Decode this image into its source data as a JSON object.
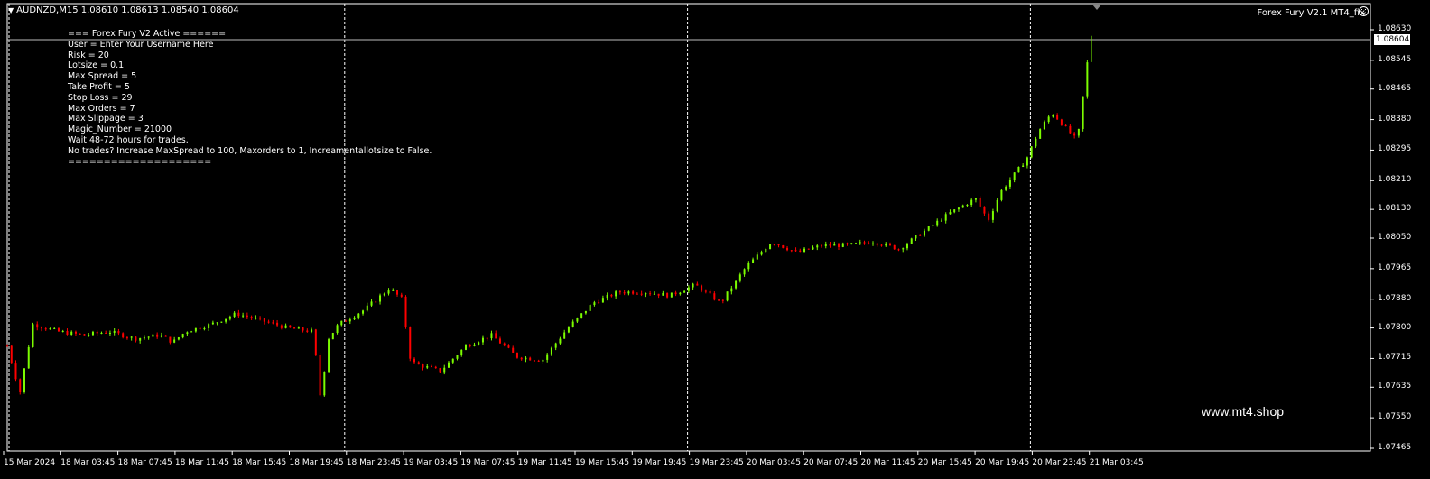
{
  "header": {
    "symbol_line": "AUDNZD,M15  1.08610 1.08613 1.08540 1.08604",
    "ea_title": "Forex Fury V2.1 MT4_fix"
  },
  "info_panel": [
    "=== Forex Fury V2 Active ======",
    "User = Enter Your Username Here",
    "Risk = 20",
    "Lotsize = 0.1",
    "Max Spread = 5",
    "Take Profit = 5",
    "Stop Loss = 29",
    "Max Orders = 7",
    "Max Slippage = 3",
    "Magic_Number = 21000",
    "Wait 48-72 hours for trades.",
    "No trades? Increase MaxSpread to 100, Maxorders to 1, Increamentallotsize to False.",
    "===================="
  ],
  "watermark": "www.mt4.shop",
  "current_price_label": "1.08604",
  "colors": {
    "bull": "#7CFC00",
    "bear": "#FF0000",
    "background": "#000000",
    "grid": "#FFFFFF"
  },
  "chart_data": {
    "type": "candlestick",
    "symbol": "AUDNZD",
    "timeframe": "M15",
    "ohlc_current": {
      "open": 1.0861,
      "high": 1.08613,
      "low": 1.0854,
      "close": 1.08604
    },
    "ylim": [
      1.07465,
      1.0866
    ],
    "y_ticks": [
      "1.08630",
      "1.08545",
      "1.08465",
      "1.08380",
      "1.08295",
      "1.08210",
      "1.08130",
      "1.08050",
      "1.07965",
      "1.07880",
      "1.07800",
      "1.07715",
      "1.07635",
      "1.07550",
      "1.07465"
    ],
    "x_ticks": [
      "15 Mar 2024",
      "18 Mar 03:45",
      "18 Mar 07:45",
      "18 Mar 11:45",
      "18 Mar 15:45",
      "18 Mar 19:45",
      "18 Mar 23:45",
      "19 Mar 03:45",
      "19 Mar 07:45",
      "19 Mar 11:45",
      "19 Mar 15:45",
      "19 Mar 19:45",
      "19 Mar 23:45",
      "20 Mar 03:45",
      "20 Mar 07:45",
      "20 Mar 11:45",
      "20 Mar 15:45",
      "20 Mar 19:45",
      "20 Mar 23:45",
      "21 Mar 03:45"
    ],
    "day_separators": [
      "15 Mar 2024",
      "18 Mar 23:45",
      "19 Mar 23:45",
      "20 Mar 23:45"
    ],
    "close_path": [
      {
        "t": 0,
        "v": 1.0775
      },
      {
        "t": 0.5,
        "v": 1.0762
      },
      {
        "t": 1,
        "v": 1.0781
      },
      {
        "t": 2,
        "v": 1.0779
      },
      {
        "t": 3,
        "v": 1.0778
      },
      {
        "t": 4,
        "v": 1.0779
      },
      {
        "t": 5,
        "v": 1.0777
      },
      {
        "t": 6,
        "v": 1.0778
      },
      {
        "t": 6.5,
        "v": 1.0776
      },
      {
        "t": 7,
        "v": 1.0779
      },
      {
        "t": 8,
        "v": 1.0781
      },
      {
        "t": 9,
        "v": 1.0784
      },
      {
        "t": 10,
        "v": 1.0782
      },
      {
        "t": 11,
        "v": 1.078
      },
      {
        "t": 12,
        "v": 1.0779
      },
      {
        "t": 12.3,
        "v": 1.076
      },
      {
        "t": 12.6,
        "v": 1.0777
      },
      {
        "t": 13,
        "v": 1.0781
      },
      {
        "t": 14,
        "v": 1.0785
      },
      {
        "t": 15,
        "v": 1.0791
      },
      {
        "t": 15.5,
        "v": 1.0788
      },
      {
        "t": 15.8,
        "v": 1.0772
      },
      {
        "t": 16,
        "v": 1.077
      },
      {
        "t": 17,
        "v": 1.0768
      },
      {
        "t": 18,
        "v": 1.0775
      },
      {
        "t": 19,
        "v": 1.0778
      },
      {
        "t": 20,
        "v": 1.0772
      },
      {
        "t": 21,
        "v": 1.0771
      },
      {
        "t": 22,
        "v": 1.078
      },
      {
        "t": 23,
        "v": 1.0787
      },
      {
        "t": 24,
        "v": 1.079
      },
      {
        "t": 25,
        "v": 1.079
      },
      {
        "t": 26,
        "v": 1.0789
      },
      {
        "t": 27,
        "v": 1.0792
      },
      {
        "t": 28,
        "v": 1.0787
      },
      {
        "t": 29,
        "v": 1.0797
      },
      {
        "t": 30,
        "v": 1.0804
      },
      {
        "t": 31,
        "v": 1.0801
      },
      {
        "t": 32,
        "v": 1.0803
      },
      {
        "t": 33,
        "v": 1.0803
      },
      {
        "t": 34,
        "v": 1.0804
      },
      {
        "t": 35,
        "v": 1.0802
      },
      {
        "t": 36,
        "v": 1.0807
      },
      {
        "t": 37,
        "v": 1.0812
      },
      {
        "t": 38,
        "v": 1.0816
      },
      {
        "t": 38.5,
        "v": 1.081
      },
      {
        "t": 39,
        "v": 1.0818
      },
      {
        "t": 40,
        "v": 1.0827
      },
      {
        "t": 40.5,
        "v": 1.0835
      },
      {
        "t": 41,
        "v": 1.084
      },
      {
        "t": 42,
        "v": 1.0832
      },
      {
        "t": 42.5,
        "v": 1.086
      }
    ]
  }
}
